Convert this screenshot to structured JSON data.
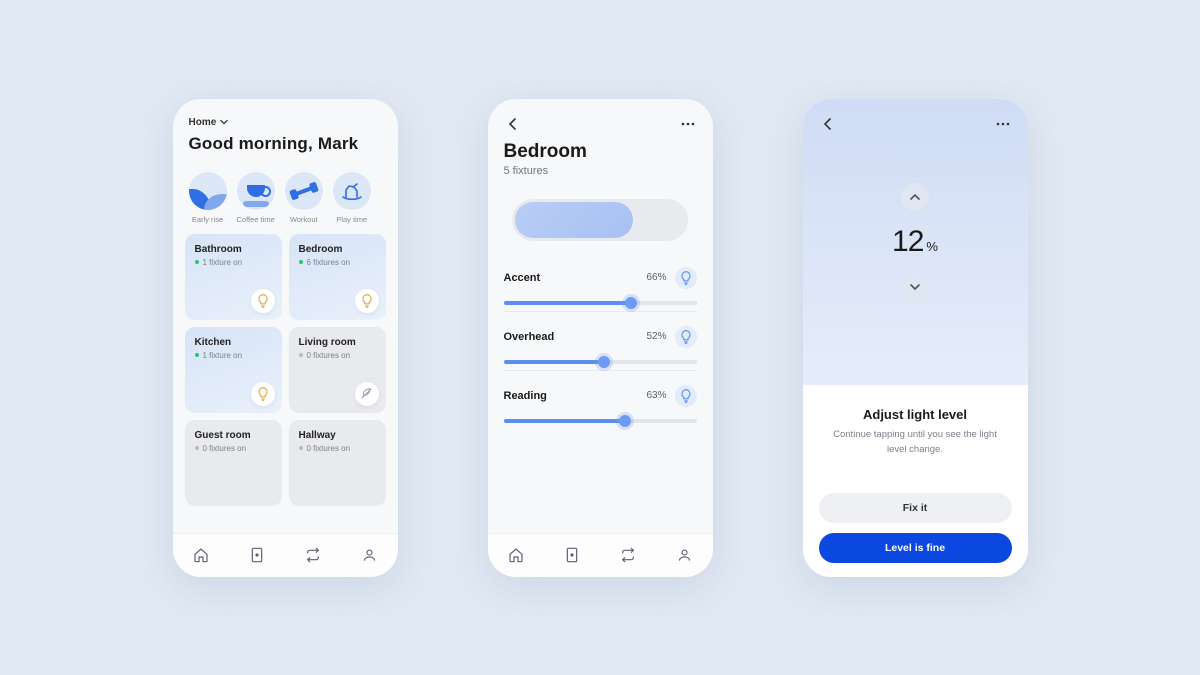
{
  "colors": {
    "accent": "#0a48e0",
    "slider": "#5a8ff0",
    "toggle": "#a8c1f3"
  },
  "screen1": {
    "selector_label": "Home",
    "greeting": "Good morning, Mark",
    "scenes": [
      {
        "label": "Early rise"
      },
      {
        "label": "Coffee time"
      },
      {
        "label": "Workout"
      },
      {
        "label": "Play time"
      }
    ],
    "rooms": [
      {
        "name": "Bathroom",
        "status": "1 fixture on",
        "on": true
      },
      {
        "name": "Bedroom",
        "status": "6 fixtures on",
        "on": true
      },
      {
        "name": "Kitchen",
        "status": "1 fixture on",
        "on": true
      },
      {
        "name": "Living room",
        "status": "0 fixtures on",
        "on": false
      },
      {
        "name": "Guest room",
        "status": "0 fixtures on",
        "on": false
      },
      {
        "name": "Hallway",
        "status": "0 fixtures on",
        "on": false
      }
    ]
  },
  "screen2": {
    "title": "Bedroom",
    "subtitle": "5 fixtures",
    "fixtures": [
      {
        "name": "Accent",
        "pct": "66%",
        "value": 66
      },
      {
        "name": "Overhead",
        "pct": "52%",
        "value": 52
      },
      {
        "name": "Reading",
        "pct": "63%",
        "value": 63
      }
    ]
  },
  "screen3": {
    "level": "12",
    "pct_symbol": "%",
    "title": "Adjust light level",
    "desc": "Continue tapping until you see the light level change.",
    "secondary_label": "Fix it",
    "primary_label": "Level is fine"
  }
}
